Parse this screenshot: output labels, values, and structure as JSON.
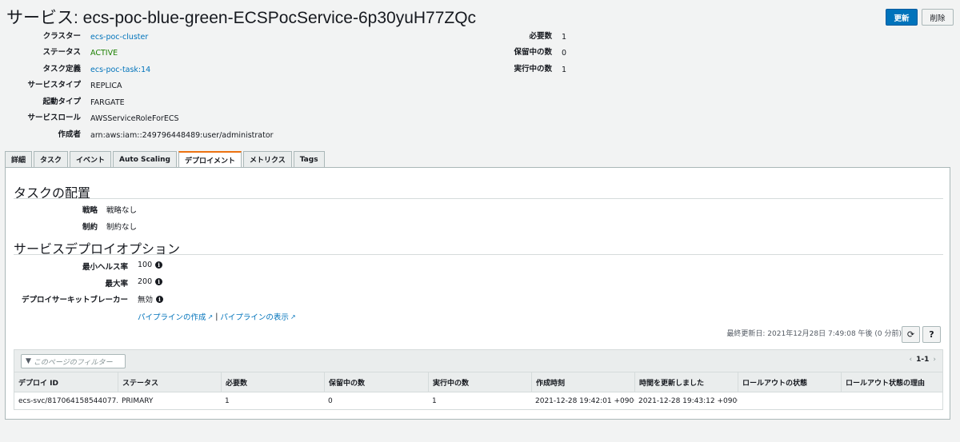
{
  "header": {
    "title": "サービス: ecs-poc-blue-green-ECSPocService-6p30yuH77ZQc",
    "refresh_label": "更新",
    "delete_label": "削除"
  },
  "summary": {
    "left": [
      {
        "label": "クラスター",
        "value": "ecs-poc-cluster",
        "kind": "link"
      },
      {
        "label": "ステータス",
        "value": "ACTIVE",
        "kind": "status"
      },
      {
        "label": "タスク定義",
        "value": "ecs-poc-task:14",
        "kind": "link"
      },
      {
        "label": "サービスタイプ",
        "value": "REPLICA",
        "kind": "text"
      },
      {
        "label": "起動タイプ",
        "value": "FARGATE",
        "kind": "text"
      },
      {
        "label": "サービスロール",
        "value": "AWSServiceRoleForECS",
        "kind": "text"
      },
      {
        "label": "作成者",
        "value": "arn:aws:iam::249796448489:user/administrator",
        "kind": "text"
      }
    ],
    "right": [
      {
        "label": "必要数",
        "value": "1"
      },
      {
        "label": "保留中の数",
        "value": "0"
      },
      {
        "label": "実行中の数",
        "value": "1"
      }
    ]
  },
  "tabs": [
    {
      "label": "詳細",
      "active": false
    },
    {
      "label": "タスク",
      "active": false
    },
    {
      "label": "イベント",
      "active": false
    },
    {
      "label": "Auto Scaling",
      "active": false
    },
    {
      "label": "デプロイメント",
      "active": true
    },
    {
      "label": "メトリクス",
      "active": false
    },
    {
      "label": "Tags",
      "active": false
    }
  ],
  "placement": {
    "heading": "タスクの配置",
    "strategy_label": "戦略",
    "strategy_value": "戦略なし",
    "constraint_label": "制約",
    "constraint_value": "制約なし"
  },
  "deploy_options": {
    "heading": "サービスデプロイオプション",
    "min_health_label": "最小ヘルス率",
    "min_health_value": "100",
    "max_label": "最大率",
    "max_value": "200",
    "breaker_label": "デプロイサーキットブレーカー",
    "breaker_value": "無効",
    "create_pipeline": "パイプラインの作成",
    "separator": "|",
    "view_pipeline": "パイプラインの表示"
  },
  "table_controls": {
    "last_updated": "最終更新日: 2021年12月28日 7:49:08 午後 (0 分前)",
    "refresh_icon": "refresh-icon",
    "help_icon": "help-icon",
    "filter_placeholder": "このページのフィルター",
    "pager_prev": "‹",
    "pager_text": "1-1",
    "pager_next": "›"
  },
  "deployments_table": {
    "columns": [
      "デプロイ ID",
      "ステータス",
      "必要数",
      "保留中の数",
      "実行中の数",
      "作成時刻",
      "時間を更新しました",
      "ロールアウトの状態",
      "ロールアウト状態の理由"
    ],
    "rows": [
      [
        "ecs-svc/817064158544077...",
        "PRIMARY",
        "1",
        "0",
        "1",
        "2021-12-28 19:42:01 +0900",
        "2021-12-28 19:43:12 +0900",
        "",
        ""
      ]
    ]
  },
  "colors": {
    "accent": "#0073bb",
    "active_tab": "#ec7211",
    "status_active": "#1d8102"
  }
}
